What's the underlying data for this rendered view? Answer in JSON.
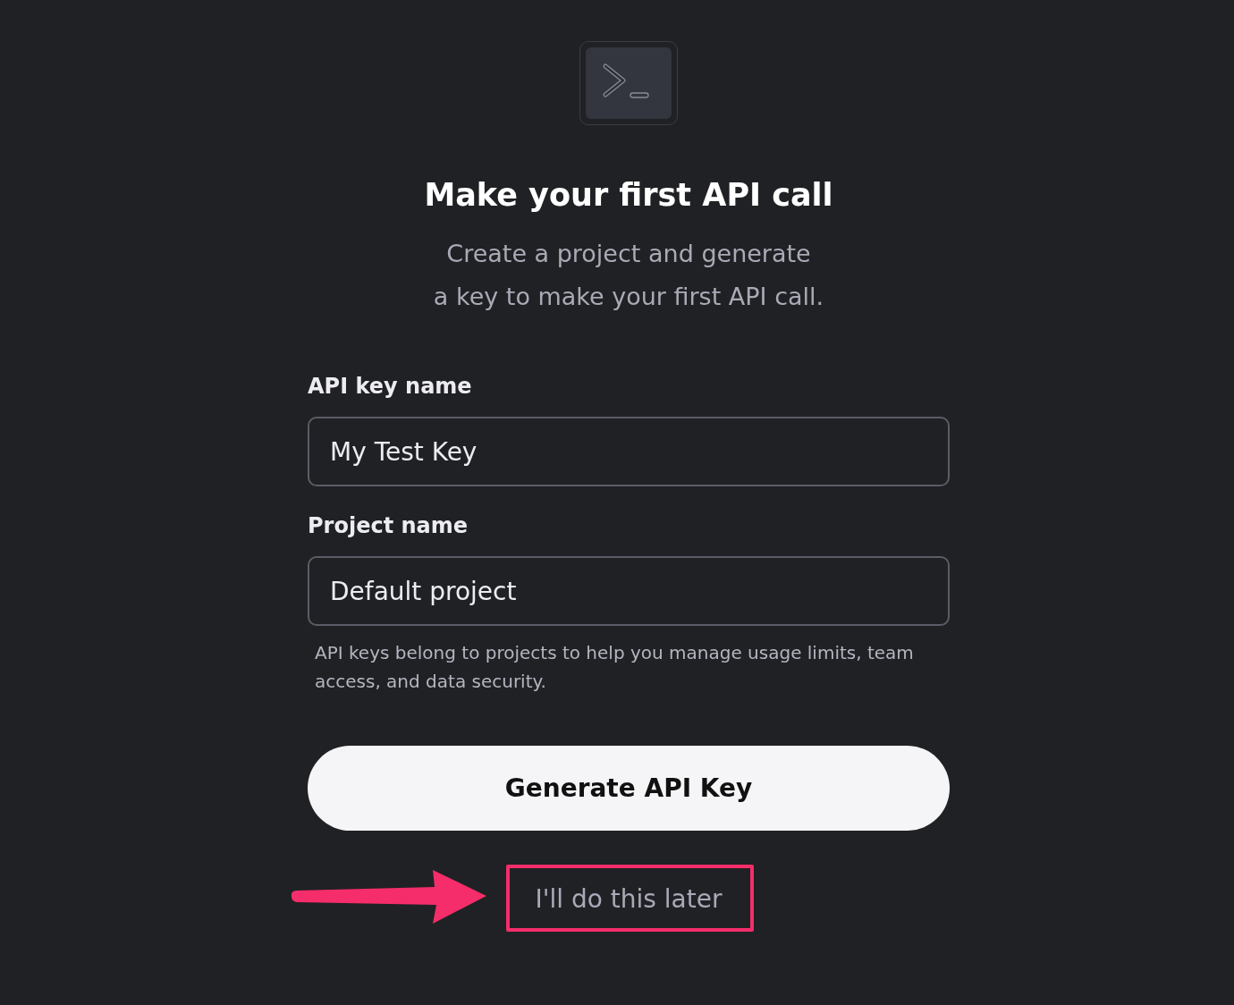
{
  "title": "Make your first API call",
  "subtitle": [
    "Create a project and generate",
    "a key to make your first API call."
  ],
  "fields": [
    {
      "label": "API key name",
      "value": "My Test Key"
    },
    {
      "label": "Project name",
      "value": "Default project"
    }
  ],
  "hint": "API keys belong to projects to help you manage usage limits, team access, and data security.",
  "primary_button": "Generate API Key",
  "secondary_link": "I'll do this later"
}
